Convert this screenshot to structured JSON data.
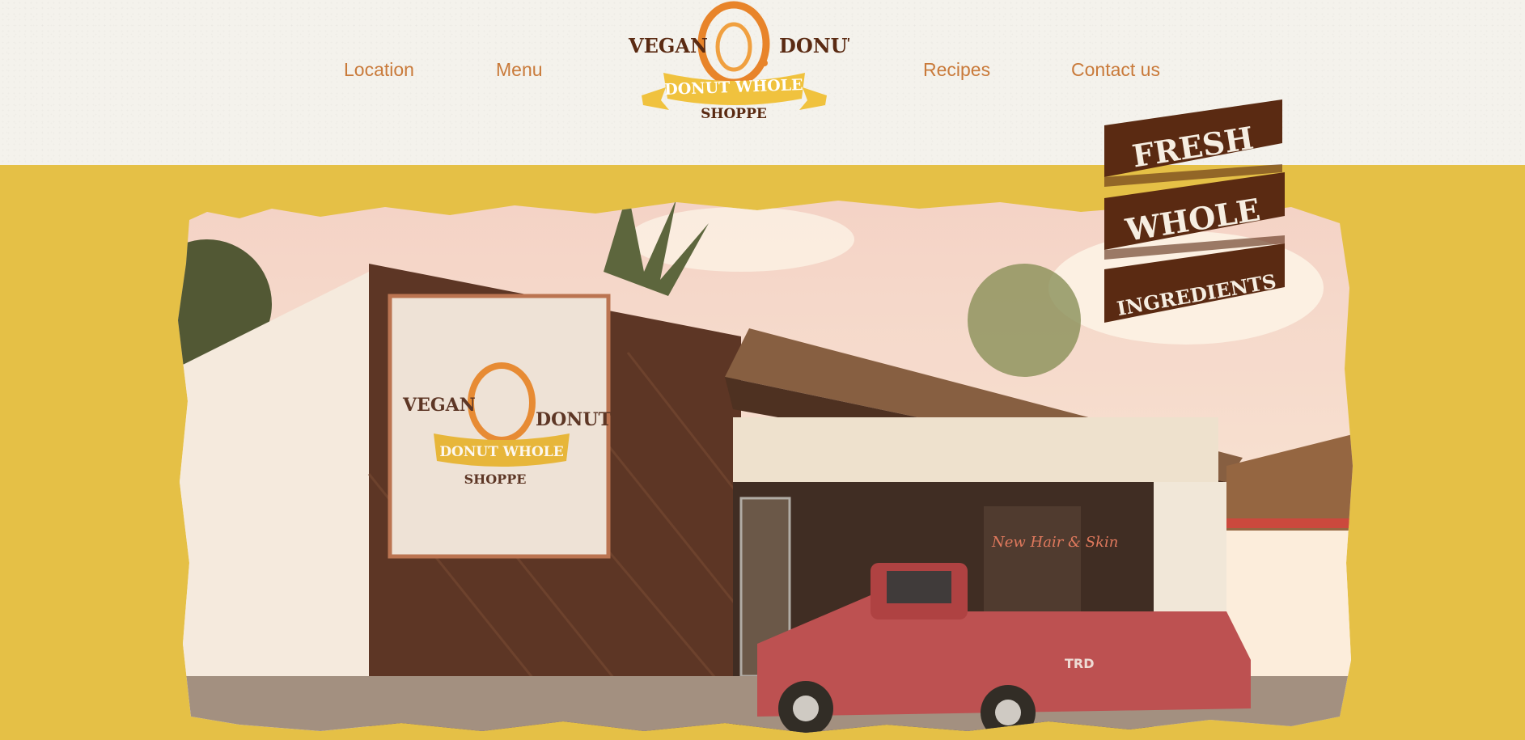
{
  "nav": {
    "location": "Location",
    "menu": "Menu",
    "recipes": "Recipes",
    "contact": "Contact us"
  },
  "logo": {
    "vegan": "VEGAN",
    "donut": "DONUT",
    "banner": "DONUT WHOLE",
    "shoppe": "SHOPPE"
  },
  "badge": {
    "line1": "FRESH",
    "line2": "WHOLE",
    "line3": "INGREDIENTS"
  },
  "storefront": {
    "sign_vegan": "VEGAN",
    "sign_donut": "DONUT",
    "sign_banner": "DONUT WHOLE",
    "sign_shoppe": "SHOPPE",
    "window_text": "New Hair & Skin",
    "truck_badge": "TRD"
  },
  "colors": {
    "page_yellow": "#e5c046",
    "header_bg": "#f4f2ec",
    "nav_text": "#c97a3a",
    "brand_brown": "#5a2a12",
    "brand_orange": "#e8842a",
    "brand_gold": "#f0c23e"
  }
}
